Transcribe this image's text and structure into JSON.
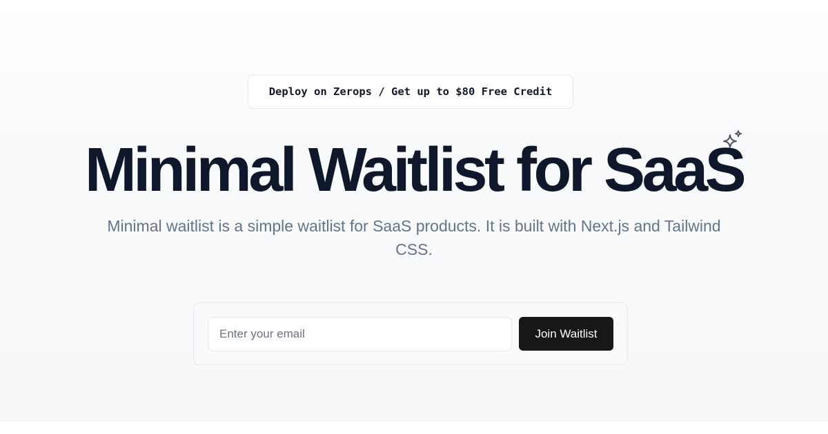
{
  "badge": {
    "text": "Deploy on Zerops / Get up to $80 Free Credit"
  },
  "hero": {
    "title": "Minimal Waitlist  for SaaS",
    "sparkle_icon": "sparkles-icon",
    "subtitle": "Minimal waitlist is a simple waitlist for SaaS products. It is built with Next.js and Tailwind CSS."
  },
  "form": {
    "email_placeholder": "Enter your email",
    "email_value": "",
    "submit_label": "Join Waitlist"
  },
  "colors": {
    "title": "#0f172a",
    "subtitle": "#64748b",
    "button_bg": "#171717",
    "button_text": "#ffffff",
    "border": "#e5e7eb"
  }
}
